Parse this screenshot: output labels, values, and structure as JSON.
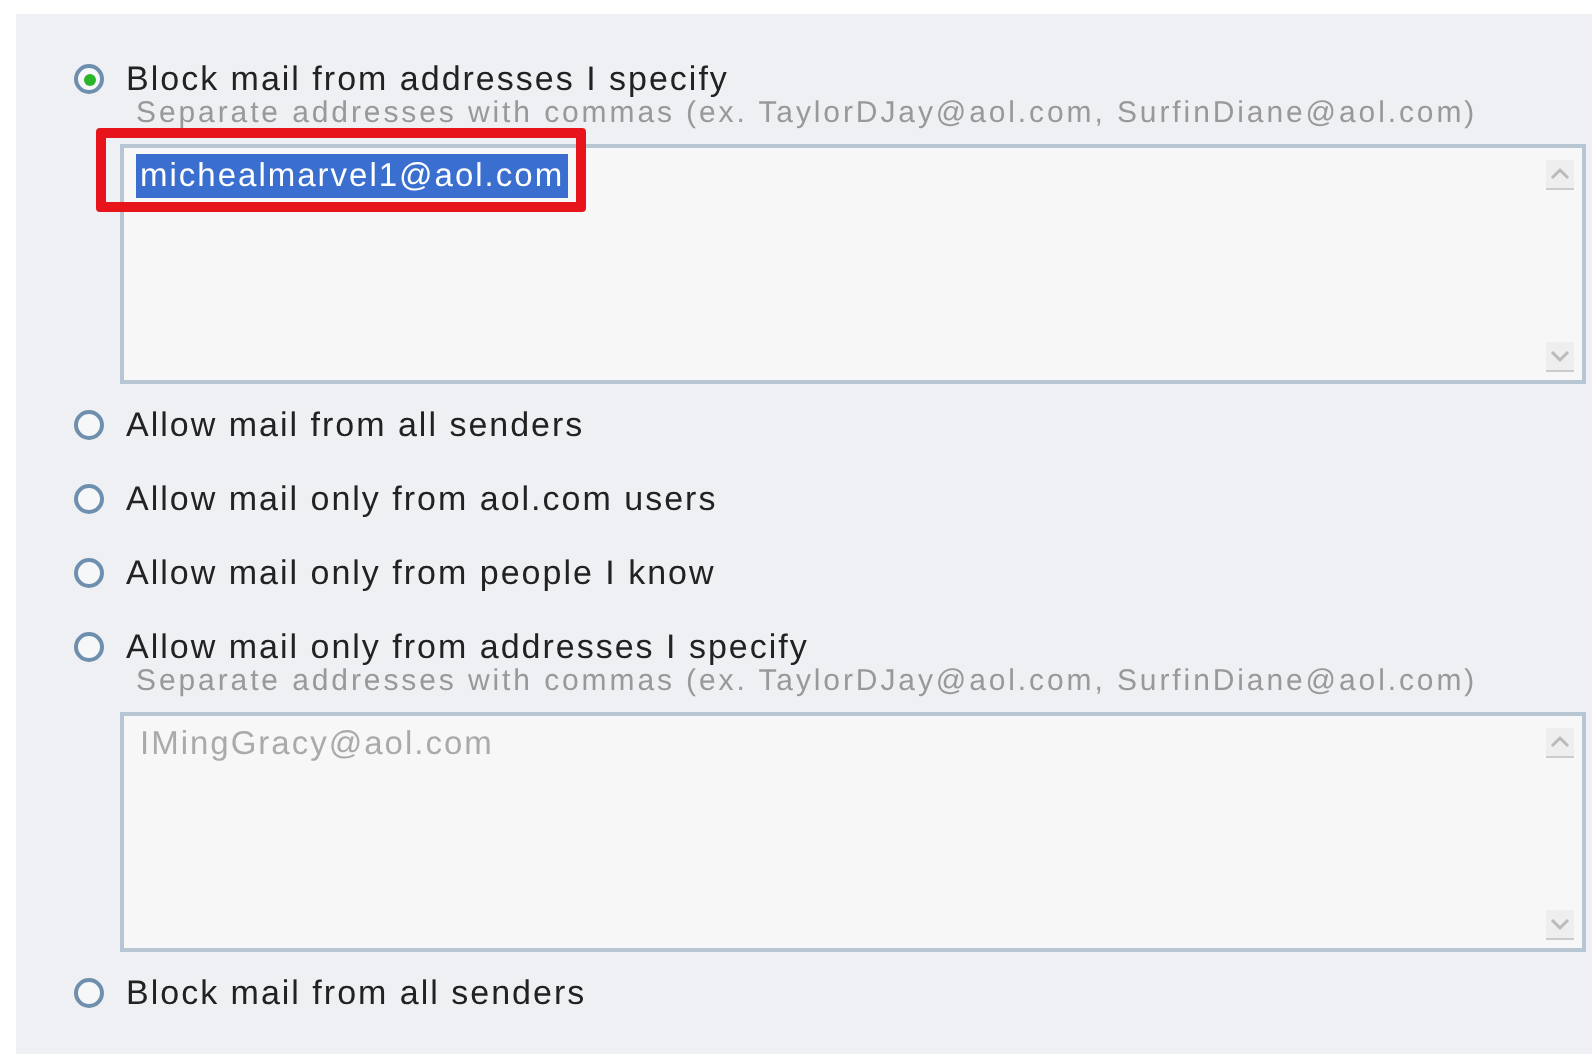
{
  "options": [
    {
      "kind": "with_field",
      "label": "Block mail from addresses I specify",
      "selected": true,
      "hint": "Separate addresses with commas (ex. TaylorDJay@aol.com, SurfinDiane@aol.com)",
      "field": {
        "value": "michealmarvel1@aol.com",
        "disabled": false,
        "text_selected": true,
        "highlighted": true
      }
    },
    {
      "kind": "plain",
      "label": "Allow mail from all senders",
      "selected": false
    },
    {
      "kind": "plain",
      "label": "Allow mail only from aol.com users",
      "selected": false
    },
    {
      "kind": "plain",
      "label": "Allow mail only from people I know",
      "selected": false
    },
    {
      "kind": "with_field",
      "label": "Allow mail only from addresses I specify",
      "selected": false,
      "hint": "Separate addresses with commas (ex. TaylorDJay@aol.com, SurfinDiane@aol.com)",
      "field": {
        "value": "IMingGracy@aol.com",
        "disabled": true,
        "text_selected": false,
        "highlighted": false
      }
    },
    {
      "kind": "plain",
      "label": "Block mail from all senders",
      "selected": false
    }
  ]
}
